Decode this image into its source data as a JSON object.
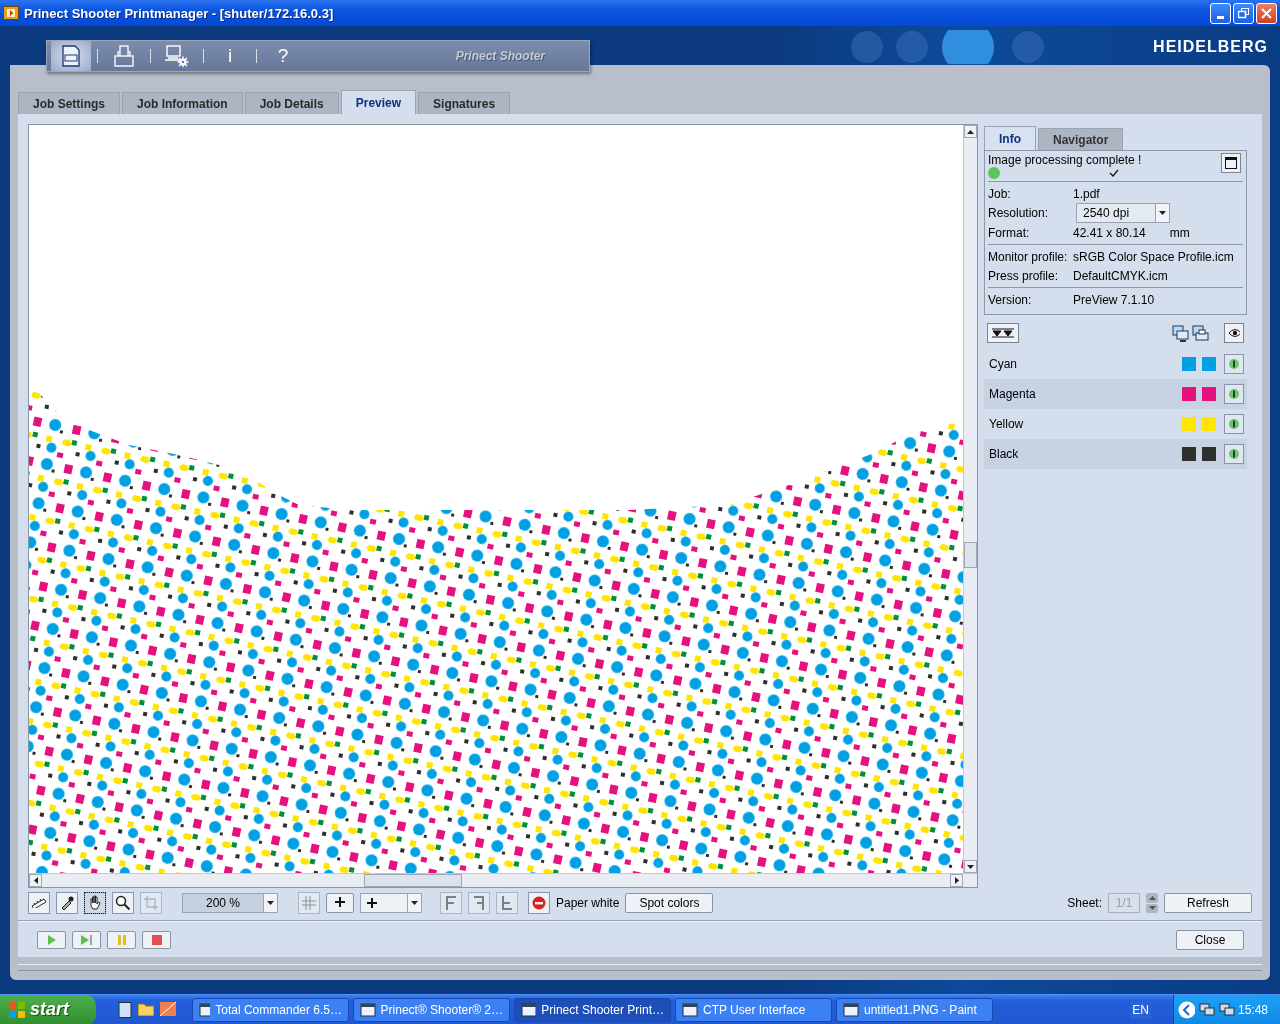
{
  "window": {
    "title": "Prinect Shooter Printmanager - [shuter/172.16.0.3]"
  },
  "app_toolbar": {
    "items": [
      {
        "kind": "document",
        "selected": true
      },
      {
        "kind": "printer",
        "selected": false
      },
      {
        "kind": "computer",
        "selected": false
      },
      {
        "kind": "text",
        "label": "i",
        "selected": false
      },
      {
        "kind": "text",
        "label": "?",
        "selected": false
      }
    ],
    "product": "Prinect Shooter"
  },
  "logo": "HEIDELBERG",
  "tabs": [
    {
      "label": "Job Settings",
      "selected": false
    },
    {
      "label": "Job Information",
      "selected": false
    },
    {
      "label": "Job Details",
      "selected": false
    },
    {
      "label": "Preview",
      "selected": true
    },
    {
      "label": "Signatures",
      "selected": false
    }
  ],
  "info_panel": {
    "tabs": [
      {
        "label": "Info",
        "selected": true
      },
      {
        "label": "Navigator",
        "selected": false
      }
    ],
    "status": "Image processing complete !",
    "groups": [
      [
        {
          "kind": "text",
          "label": "Job:",
          "value": "1.pdf"
        },
        {
          "kind": "dropdown",
          "label": "Resolution:",
          "value": "2540 dpi"
        },
        {
          "kind": "text",
          "label": "Format:",
          "value": "42.41 x 80.14",
          "unit": "mm"
        }
      ],
      [
        {
          "kind": "text",
          "label": "Monitor profile:",
          "value": "sRGB Color Space Profile.icm"
        },
        {
          "kind": "text",
          "label": "Press profile:",
          "value": "DefaultCMYK.icm"
        }
      ],
      [
        {
          "kind": "text",
          "label": "Version:",
          "value": "PreView 7.1.10"
        }
      ]
    ]
  },
  "separations": [
    {
      "name": "Cyan",
      "color": "#00a0e3",
      "visible": true
    },
    {
      "name": "Magenta",
      "color": "#e4117f",
      "visible": true
    },
    {
      "name": "Yellow",
      "color": "#ffe500",
      "visible": true
    },
    {
      "name": "Black",
      "color": "#2f2f2f",
      "visible": true
    }
  ],
  "view_toolbar": {
    "tools": [
      {
        "kind": "ruler",
        "selected": false
      },
      {
        "kind": "eyedropper",
        "selected": false
      },
      {
        "kind": "hand",
        "selected": true
      },
      {
        "kind": "magnifier",
        "selected": false
      },
      {
        "kind": "crop",
        "selected": false
      }
    ],
    "zoom": "200 %",
    "paper_white": "Paper white",
    "spot_colors": "Spot colors",
    "sheet_label": "Sheet:",
    "sheet": "1/1",
    "refresh": "Refresh"
  },
  "close": "Close",
  "taskbar": {
    "start": "start",
    "tasks": [
      {
        "label": "Total Commander 6.5…",
        "selected": false
      },
      {
        "label": "Prinect® Shooter® 2…",
        "selected": false
      },
      {
        "label": "Prinect Shooter Print…",
        "selected": true
      },
      {
        "label": "CTP User Interface",
        "selected": false
      },
      {
        "label": "untitled1.PNG - Paint",
        "selected": false
      }
    ],
    "language": "EN",
    "clock": "15:48"
  }
}
